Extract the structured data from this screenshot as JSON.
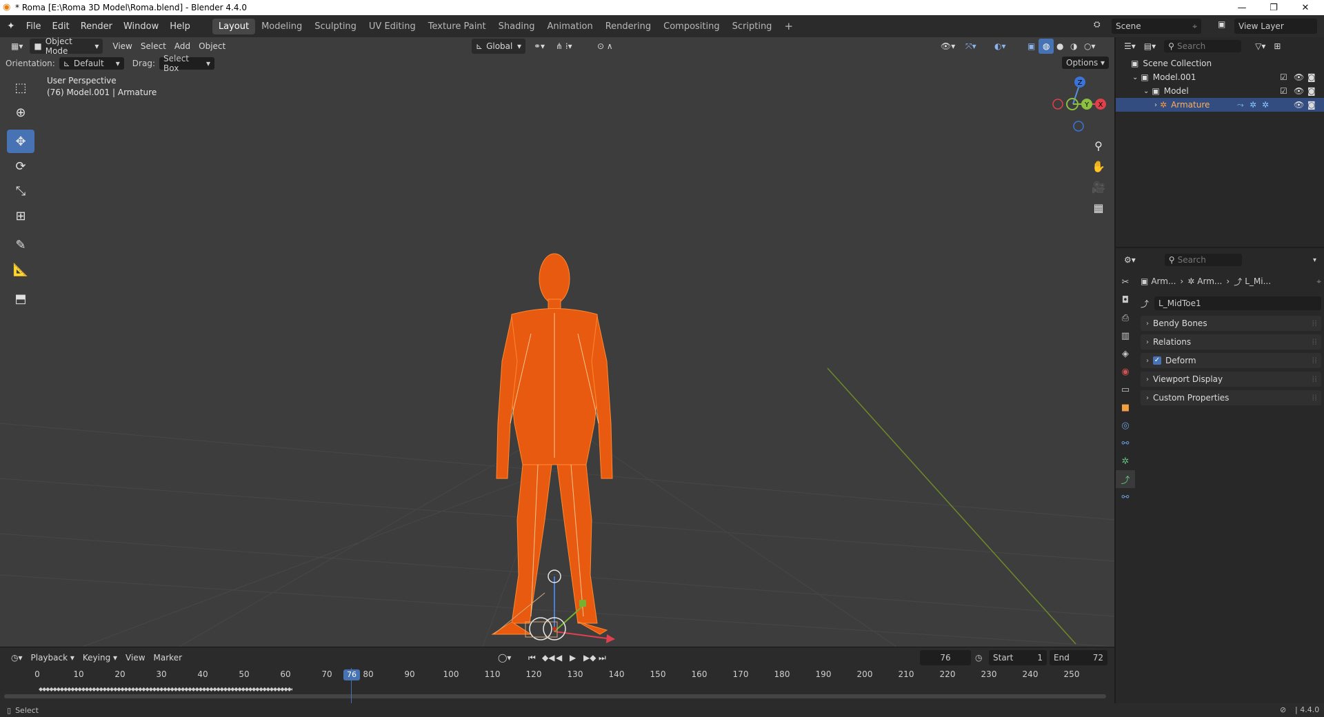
{
  "window": {
    "title": "* Roma [E:\\Roma 3D Model\\Roma.blend] - Blender 4.4.0",
    "controls": [
      "—",
      "❐",
      "✕"
    ]
  },
  "menu": {
    "items": [
      "File",
      "Edit",
      "Render",
      "Window",
      "Help"
    ],
    "workspaces": [
      "Layout",
      "Modeling",
      "Sculpting",
      "UV Editing",
      "Texture Paint",
      "Shading",
      "Animation",
      "Rendering",
      "Compositing",
      "Scripting"
    ],
    "active_workspace": "Layout",
    "add_tab": "+",
    "scene_label": "Scene",
    "view_layer_label": "View Layer"
  },
  "viewport": {
    "mode": "Object Mode",
    "menus": [
      "View",
      "Select",
      "Add",
      "Object"
    ],
    "transform_orientation": "Global",
    "orientation_label": "Orientation:",
    "orientation_value": "Default",
    "drag_label": "Drag:",
    "drag_value": "Select Box",
    "options_label": "Options",
    "overlay_title": "User Perspective",
    "overlay_subtitle": "(76) Model.001 | Armature",
    "gizmo_axes": {
      "x": "X",
      "y": "Y",
      "z": "Z"
    },
    "tools": [
      "select-box",
      "cursor",
      "move",
      "rotate",
      "scale",
      "transform",
      "annotate",
      "measure",
      "add-cube"
    ],
    "active_tool": "move"
  },
  "timeline": {
    "menus": [
      "Playback",
      "Keying",
      "View",
      "Marker"
    ],
    "current_frame": "76",
    "start_label": "Start",
    "start_value": "1",
    "end_label": "End",
    "end_value": "72",
    "ticks": [
      "0",
      "10",
      "20",
      "30",
      "40",
      "50",
      "60",
      "70",
      "80",
      "90",
      "100",
      "110",
      "120",
      "130",
      "140",
      "150",
      "160",
      "170",
      "180",
      "190",
      "200",
      "210",
      "220",
      "230",
      "240",
      "250"
    ]
  },
  "statusbar": {
    "left": "Select",
    "version": "4.4.0"
  },
  "outliner": {
    "search_placeholder": "Search",
    "rows": [
      {
        "label": "Scene Collection",
        "depth": 0
      },
      {
        "label": "Model.001",
        "depth": 1
      },
      {
        "label": "Model",
        "depth": 2
      },
      {
        "label": "Armature",
        "depth": 3,
        "selected": true
      }
    ]
  },
  "properties": {
    "search_placeholder": "Search",
    "breadcrumb": [
      "Arm...",
      "Arm...",
      "L_Mi..."
    ],
    "bone_name": "L_MidToe1",
    "panels": [
      {
        "label": "Bendy Bones",
        "checkbox": false
      },
      {
        "label": "Relations",
        "checkbox": false
      },
      {
        "label": "Deform",
        "checkbox": true
      },
      {
        "label": "Viewport Display",
        "checkbox": false
      },
      {
        "label": "Custom Properties",
        "checkbox": false
      }
    ]
  },
  "colors": {
    "accent": "#4772b3",
    "selection": "#334d80",
    "armature_orange": "#ff6a00",
    "viewport_bg": "#3d3d3d"
  }
}
